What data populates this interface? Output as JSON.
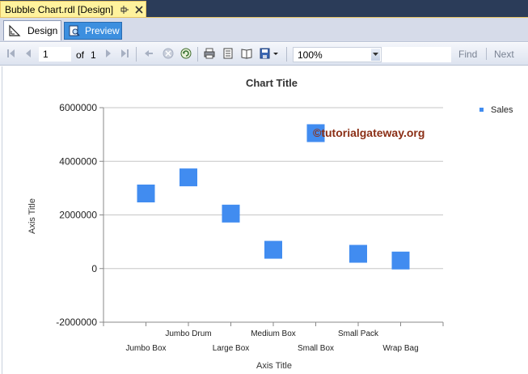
{
  "document_tab": {
    "title": "Bubble Chart.rdl [Design]"
  },
  "view_tabs": {
    "design": "Design",
    "preview": "Preview"
  },
  "toolbar": {
    "page_current": "1",
    "of_label": "of",
    "page_total": "1",
    "zoom": "100%",
    "find_label": "Find",
    "next_label": "Next"
  },
  "colors": {
    "doc_strip": "#2b3c59",
    "doc_tab": "#fff29d",
    "preview_tab": "#3c8fdf",
    "bubble": "#418cf0",
    "watermark": "#8b2f16"
  },
  "watermark": {
    "text": "©tutorialgateway.org"
  },
  "chart_data": {
    "type": "scatter",
    "title": "Chart Title",
    "xlabel": "Axis Title",
    "ylabel": "Axis Title",
    "ylim": [
      -2000000,
      6000000
    ],
    "yticks": [
      "6000000",
      "4000000",
      "2000000",
      "0",
      "-2000000"
    ],
    "ytick_values": [
      6000000,
      4000000,
      2000000,
      0,
      -2000000
    ],
    "categories": [
      "Jumbo Box",
      "Jumbo Drum",
      "Large Box",
      "Medium Box",
      "Small Box",
      "Small Pack",
      "Wrap Bag"
    ],
    "series": [
      {
        "name": "Sales",
        "values": [
          2800000,
          3400000,
          2050000,
          700000,
          5050000,
          550000,
          300000
        ]
      }
    ],
    "legend": "top-right",
    "grid": true
  }
}
